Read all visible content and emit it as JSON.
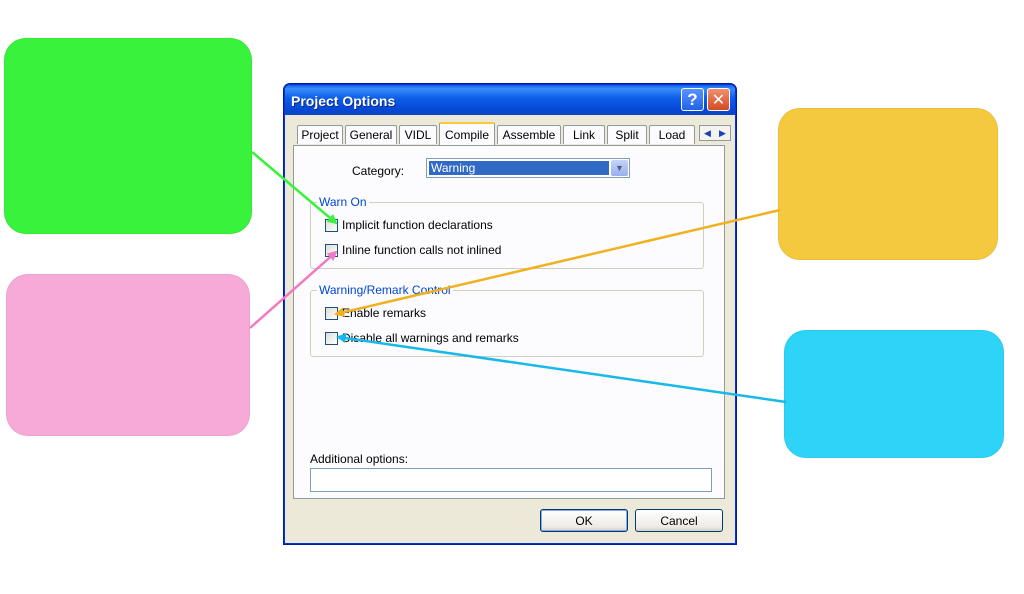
{
  "callouts": {
    "green": "#39f23c",
    "pink": "#f7aad8",
    "yellow": "#f5c93d",
    "cyan": "#2ed4f7"
  },
  "dialog": {
    "title": "Project Options",
    "help_icon": "question-mark-icon",
    "close_icon": "close-x-icon",
    "tabs": [
      "Project",
      "General",
      "VIDL",
      "Compile",
      "Assemble",
      "Link",
      "Split",
      "Load"
    ],
    "active_tab": "Compile",
    "category_label": "Category:",
    "category_value": "Warning",
    "warn_on_legend": "Warn On",
    "warn_on_items": [
      "Implicit function declarations",
      "Inline function calls not inlined"
    ],
    "remark_legend": "Warning/Remark Control",
    "remark_items": [
      "Enable remarks",
      "Disable all warnings and remarks"
    ],
    "additional_label": "Additional options:",
    "additional_value": "",
    "ok_label": "OK",
    "cancel_label": "Cancel"
  }
}
